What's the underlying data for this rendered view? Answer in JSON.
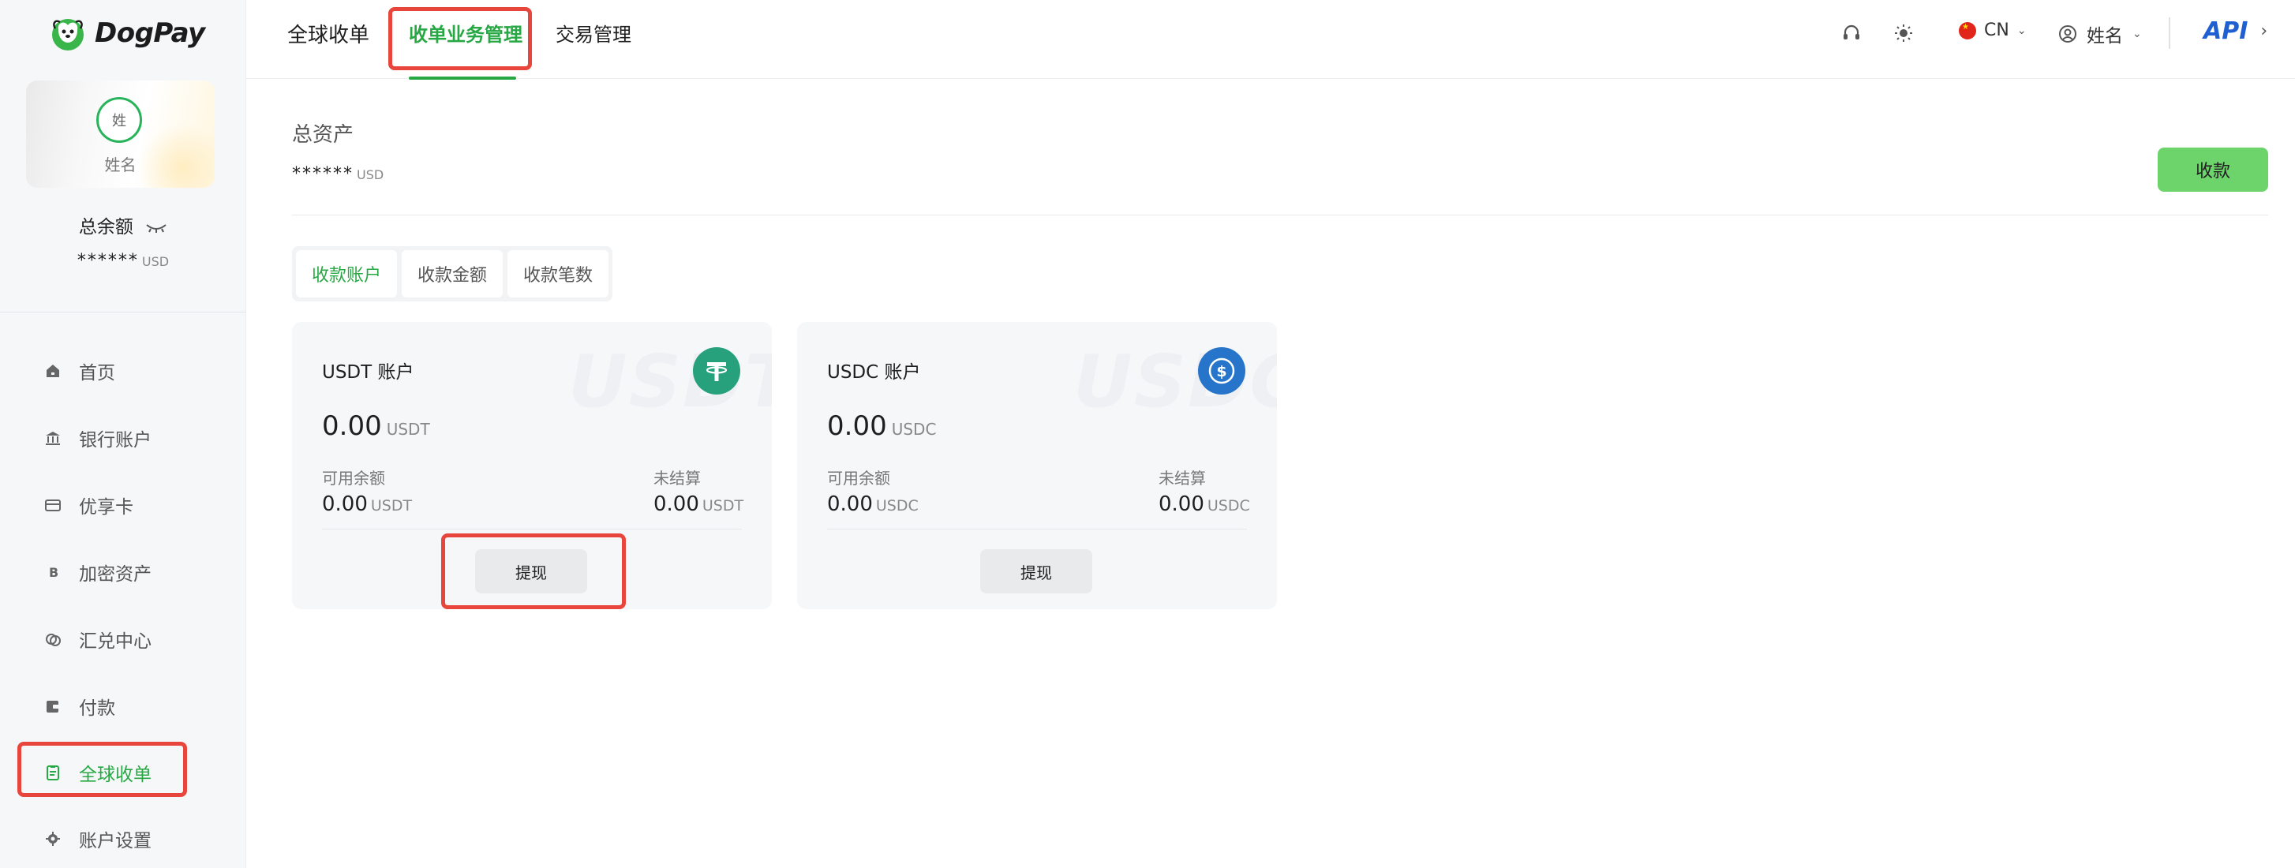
{
  "brand": {
    "name": "DogPay"
  },
  "profile": {
    "avatar_text": "姓",
    "name": "姓名"
  },
  "sidebar": {
    "balance_label": "总余额",
    "balance_masked": "******",
    "balance_unit": "USD",
    "items": [
      {
        "label": "首页",
        "icon": "home-icon"
      },
      {
        "label": "银行账户",
        "icon": "bank-icon"
      },
      {
        "label": "优享卡",
        "icon": "card-icon"
      },
      {
        "label": "加密资产",
        "icon": "bitcoin-icon"
      },
      {
        "label": "汇兑中心",
        "icon": "exchange-icon"
      },
      {
        "label": "付款",
        "icon": "wallet-icon"
      },
      {
        "label": "全球收单",
        "icon": "receipt-icon",
        "active": true
      },
      {
        "label": "账户设置",
        "icon": "gear-icon"
      }
    ]
  },
  "header": {
    "tabs": [
      {
        "label": "全球收单"
      },
      {
        "label": "收单业务管理",
        "active": true
      },
      {
        "label": "交易管理"
      }
    ],
    "language": "CN",
    "user_name": "姓名",
    "api_label": "API"
  },
  "main": {
    "total_label": "总资产",
    "total_masked": "******",
    "total_unit": "USD",
    "collect_button": "收款",
    "segments": [
      {
        "label": "收款账户",
        "active": true
      },
      {
        "label": "收款金额"
      },
      {
        "label": "收款笔数"
      }
    ],
    "accounts": [
      {
        "title": "USDT 账户",
        "watermark": "USDT",
        "amount": "0.00",
        "unit": "USDT",
        "available_label": "可用余额",
        "available_value": "0.00",
        "unsettled_label": "未结算",
        "unsettled_value": "0.00",
        "withdraw_label": "提现",
        "coin_color": "#26a17b",
        "coin_icon": "tether-icon"
      },
      {
        "title": "USDC 账户",
        "watermark": "USDC",
        "amount": "0.00",
        "unit": "USDC",
        "available_label": "可用余额",
        "available_value": "0.00",
        "unsettled_label": "未结算",
        "unsettled_value": "0.00",
        "withdraw_label": "提现",
        "coin_color": "#2775ca",
        "coin_icon": "usdc-icon"
      }
    ]
  },
  "colors": {
    "accent": "#27a844",
    "collect_button": "#6cd46b",
    "highlight": "#e8453c",
    "api": "#1f5fd1"
  }
}
